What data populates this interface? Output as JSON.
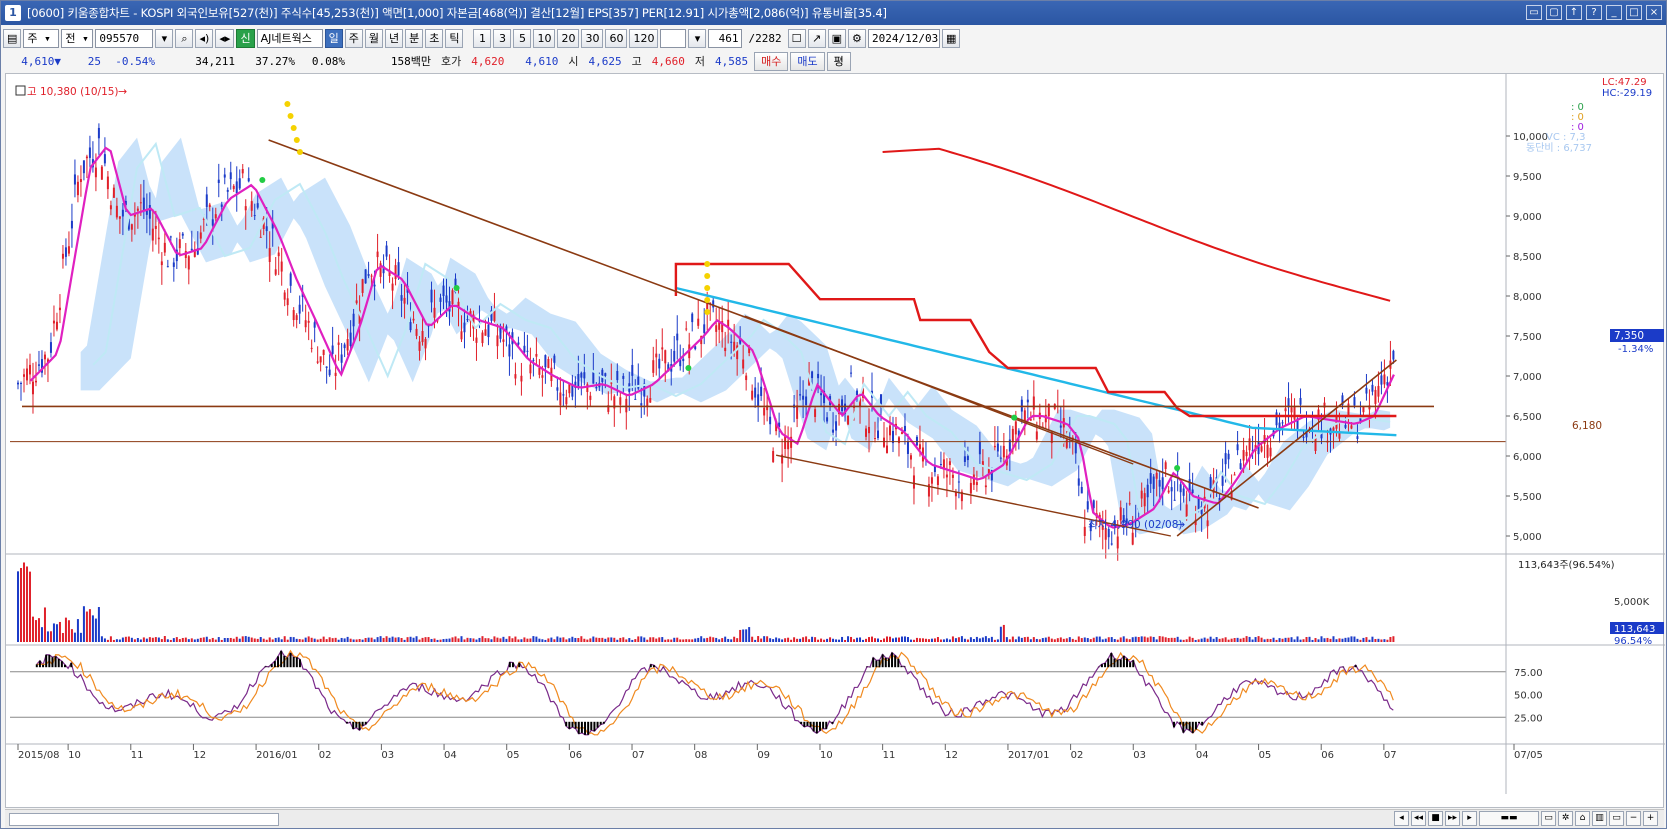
{
  "window": {
    "title": "[0600] 키움종합차트 - KOSPI 외국인보유[527(천)] 주식수[45,253(천)] 액면[1,000] 자본금[468(억)] 결산[12월] EPS[357] PER[12.91] 시가총액[2,086(억)] 유통비율[35.4]",
    "icon_label": "1"
  },
  "toolbar": {
    "period_select": "주",
    "nav_select": "전",
    "stock_code": "095570",
    "credit_badge": "신",
    "stock_name": "AJ네트웍스",
    "period_buttons": [
      "일",
      "주",
      "월",
      "년",
      "분",
      "초",
      "틱"
    ],
    "active_period": "일",
    "interval_buttons": [
      "1",
      "3",
      "5",
      "10",
      "20",
      "30",
      "60",
      "120"
    ],
    "count_value": "461",
    "total_count": "/2282",
    "date_value": "2024/12/03"
  },
  "quote": {
    "price": "4,610",
    "change_arrow": "▼",
    "change": "25",
    "change_pct": "-0.54%",
    "volume": "34,211",
    "turnover_pct": "37.27%",
    "ratio_pct": "0.08%",
    "amount": "158백만",
    "ask_label": "호가",
    "ask1": "4,620",
    "ask2": "4,610",
    "open_label": "시",
    "open": "4,625",
    "high_label": "고",
    "high": "4,660",
    "low_label": "저",
    "low": "4,585",
    "buy_label": "매수",
    "sell_label": "매도",
    "avg_label": "평"
  },
  "colors": {
    "title_bg": "#2b56a3",
    "up": "#e0202a",
    "down": "#1b3bc8",
    "ma_main": "#e020c0",
    "cloud": "#9ccaf5",
    "trend": "#8b3a12",
    "red_line": "#e01818",
    "cyan_line": "#22b8e8",
    "stoch1": "#7a2a8a",
    "stoch2": "#f08a20"
  },
  "chart_data": {
    "type": "line",
    "title": "",
    "price_axis": {
      "ticks": [
        5000,
        5500,
        6000,
        6500,
        7000,
        7500,
        8000,
        8500,
        9000,
        9500,
        10000
      ],
      "tick_labels": [
        "5,000",
        "5,500",
        "6,000",
        "6,500",
        "7,000",
        "7,500",
        "8,000",
        "8,500",
        "9,000",
        "9,500",
        "10,000"
      ],
      "range": [
        4800,
        10700
      ]
    },
    "x_axis": {
      "labels": [
        "2015/08",
        "10",
        "11",
        "12",
        "2016/01",
        "02",
        "03",
        "04",
        "05",
        "06",
        "07",
        "08",
        "09",
        "10",
        "11",
        "12",
        "2017/01",
        "02",
        "03",
        "04",
        "05",
        "06",
        "07",
        "07/05"
      ]
    },
    "lc_label": "LC:47.29",
    "hc_label": "HC:-29.19",
    "max_marker": "고 10,380 (10/15)",
    "min_marker": "최저 4,990 (02/08)",
    "level_label": "6,180",
    "level_value": 6180,
    "support_value": 6620,
    "price_label": "7,350",
    "price_change_label": "-1.34%",
    "legend_right": [
      ": 0",
      ": 0",
      ": 0"
    ],
    "legend_right_text": [
      "VC : 7,3",
      "동단비 : 6,737"
    ],
    "price_series": {
      "name": "",
      "x_month_index": [
        0,
        0.5,
        1.0,
        1.3,
        1.6,
        2.0,
        2.4,
        2.8,
        3.2,
        3.6,
        4.0,
        4.3,
        4.6,
        5.0,
        5.3,
        5.6,
        6.0,
        6.4,
        6.8,
        7.2,
        7.6,
        8.0,
        8.4,
        8.8,
        9.2,
        9.6,
        10.0,
        10.4,
        10.8,
        11.0,
        11.2,
        11.6,
        12.0,
        12.3,
        12.6,
        13.0,
        13.3,
        13.6,
        14.0,
        14.4,
        14.8,
        15.2,
        15.6,
        16.0,
        16.2,
        16.4,
        16.6,
        16.8,
        17.0,
        17.3,
        17.6,
        18.0,
        18.3,
        18.6,
        19.0,
        19.3,
        19.6,
        20.0,
        20.4,
        20.8,
        21.2,
        21.5,
        21.8,
        22.0
      ],
      "values": [
        6900,
        7300,
        9600,
        9900,
        9000,
        9100,
        8500,
        8600,
        9200,
        9400,
        8800,
        8200,
        7700,
        7000,
        7600,
        8400,
        8200,
        7600,
        7900,
        7700,
        7600,
        7200,
        7000,
        6850,
        6900,
        6750,
        6900,
        7200,
        7500,
        7700,
        7600,
        7300,
        6300,
        6150,
        6900,
        6500,
        6800,
        6500,
        6300,
        5900,
        5800,
        5700,
        5900,
        6500,
        6500,
        6450,
        6400,
        6200,
        5300,
        5100,
        5150,
        5350,
        5800,
        5500,
        5400,
        5700,
        6100,
        6350,
        6500,
        6450,
        6400,
        6500,
        7000,
        7350
      ]
    },
    "volume_axis": {
      "tick_labels": [
        "5,000K"
      ],
      "top_label": "113,643주(96.54%)",
      "current_label": "113,643",
      "current_pct": "96.54%"
    },
    "stoch_axis": {
      "tick_labels": [
        "75.00",
        "50.00",
        "25.00"
      ],
      "range": [
        0,
        100
      ]
    }
  },
  "bottombar": {
    "nav_icons": [
      "first-icon",
      "prev-icon",
      "stop-icon",
      "next-icon",
      "last-icon",
      "range-icon",
      "window-icon",
      "settings-icon",
      "tool-icon",
      "chart-icon",
      "shrink-icon",
      "zoom-out-icon",
      "zoom-in-icon"
    ]
  }
}
